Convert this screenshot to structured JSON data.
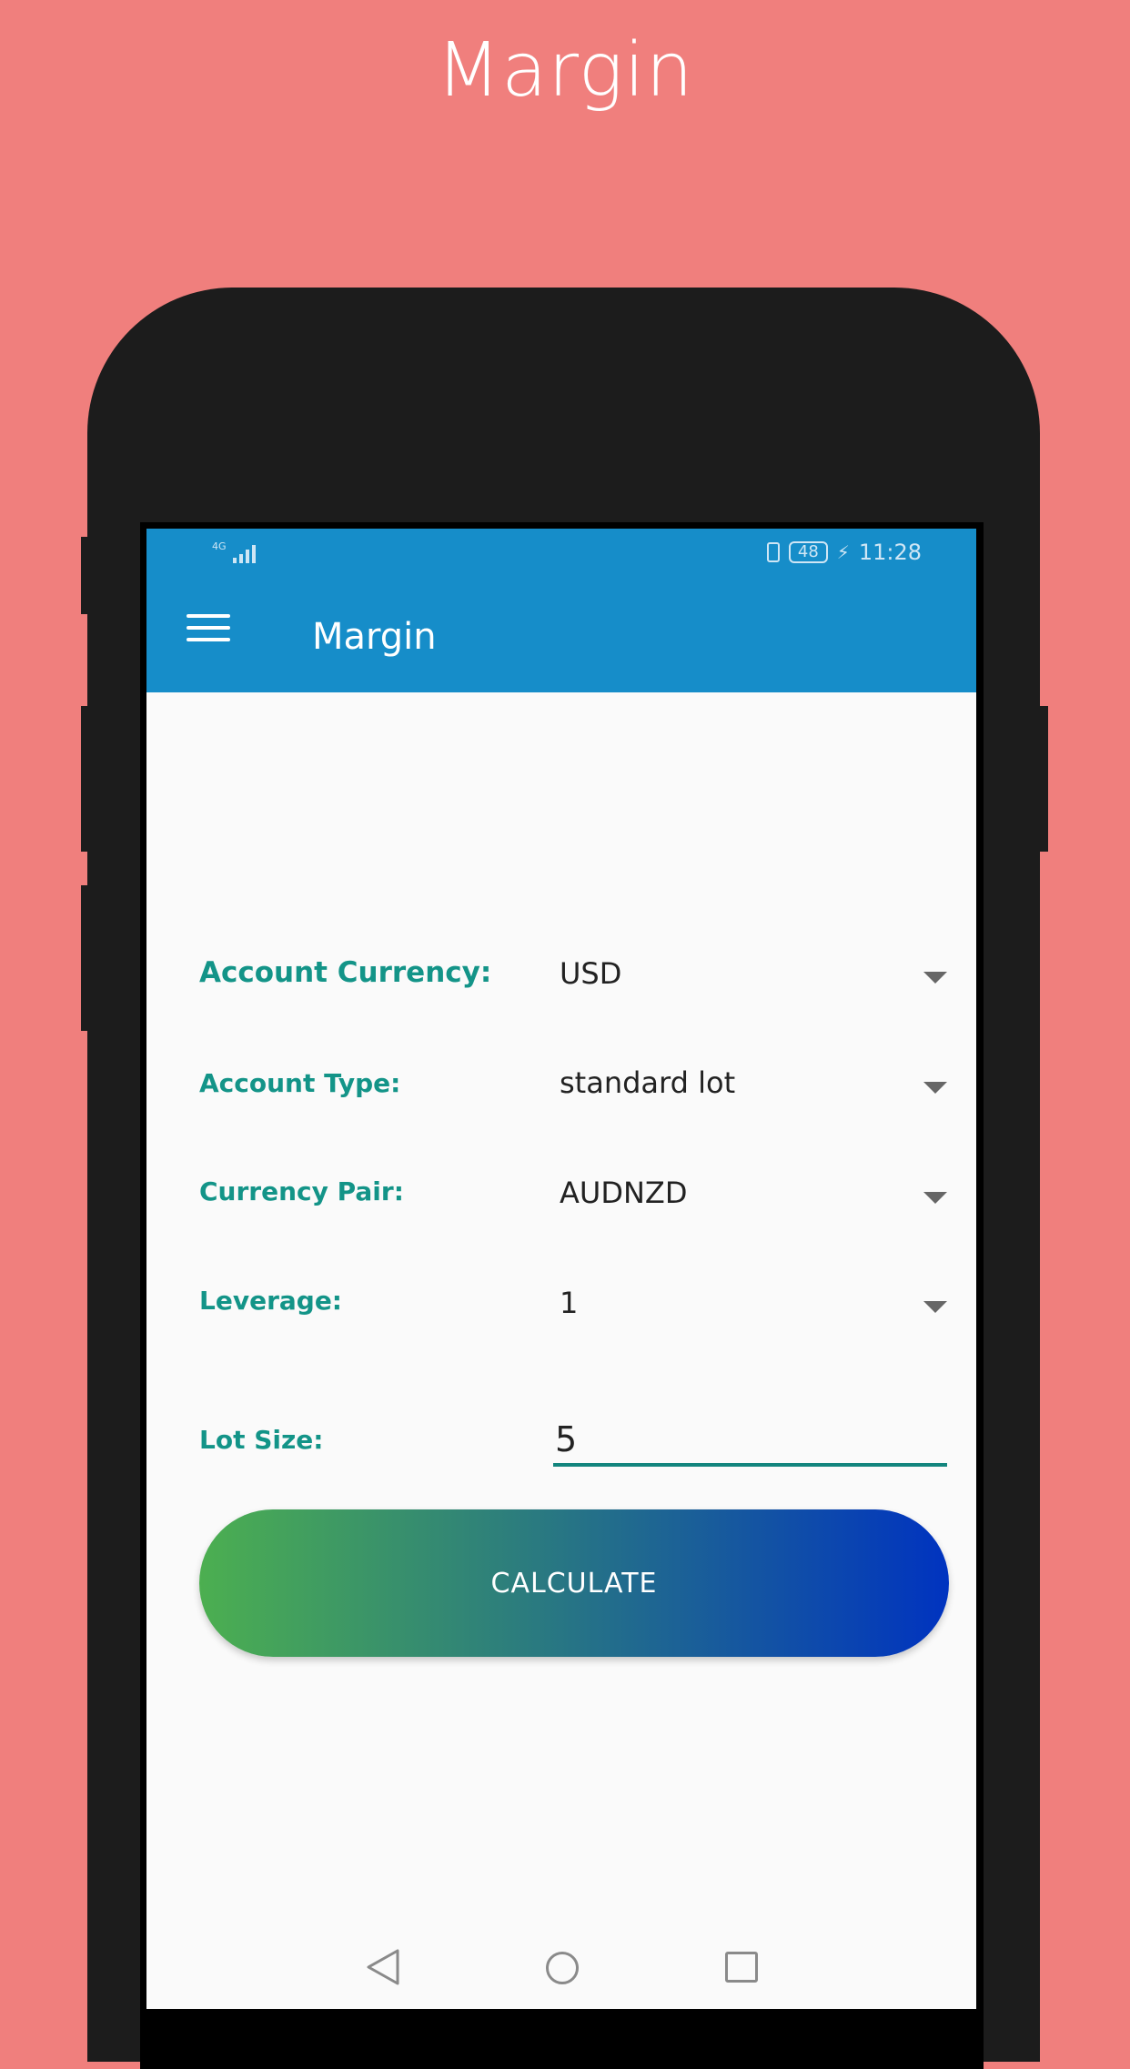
{
  "promo": {
    "title": "Margin"
  },
  "status_bar": {
    "network": "4G",
    "battery": "48",
    "time": "11:28"
  },
  "app_bar": {
    "title": "Margin"
  },
  "form": {
    "account_currency": {
      "label": "Account Currency:",
      "value": "USD"
    },
    "account_type": {
      "label": "Account Type:",
      "value": "standard lot"
    },
    "currency_pair": {
      "label": "Currency Pair:",
      "value": "AUDNZD"
    },
    "leverage": {
      "label": "Leverage:",
      "value": "1"
    },
    "lot_size": {
      "label": "Lot Size:",
      "value": "5"
    }
  },
  "calculate_label": "CALCULATE",
  "colors": {
    "background": "#f07f7d",
    "app_bar": "#168dc9",
    "label": "#139488",
    "button_start": "#4caf50",
    "button_end": "#0033c0"
  },
  "icons": [
    "menu-icon",
    "caret-down-icon",
    "back-icon",
    "home-icon",
    "recent-apps-icon",
    "battery-icon",
    "signal-icon"
  ]
}
